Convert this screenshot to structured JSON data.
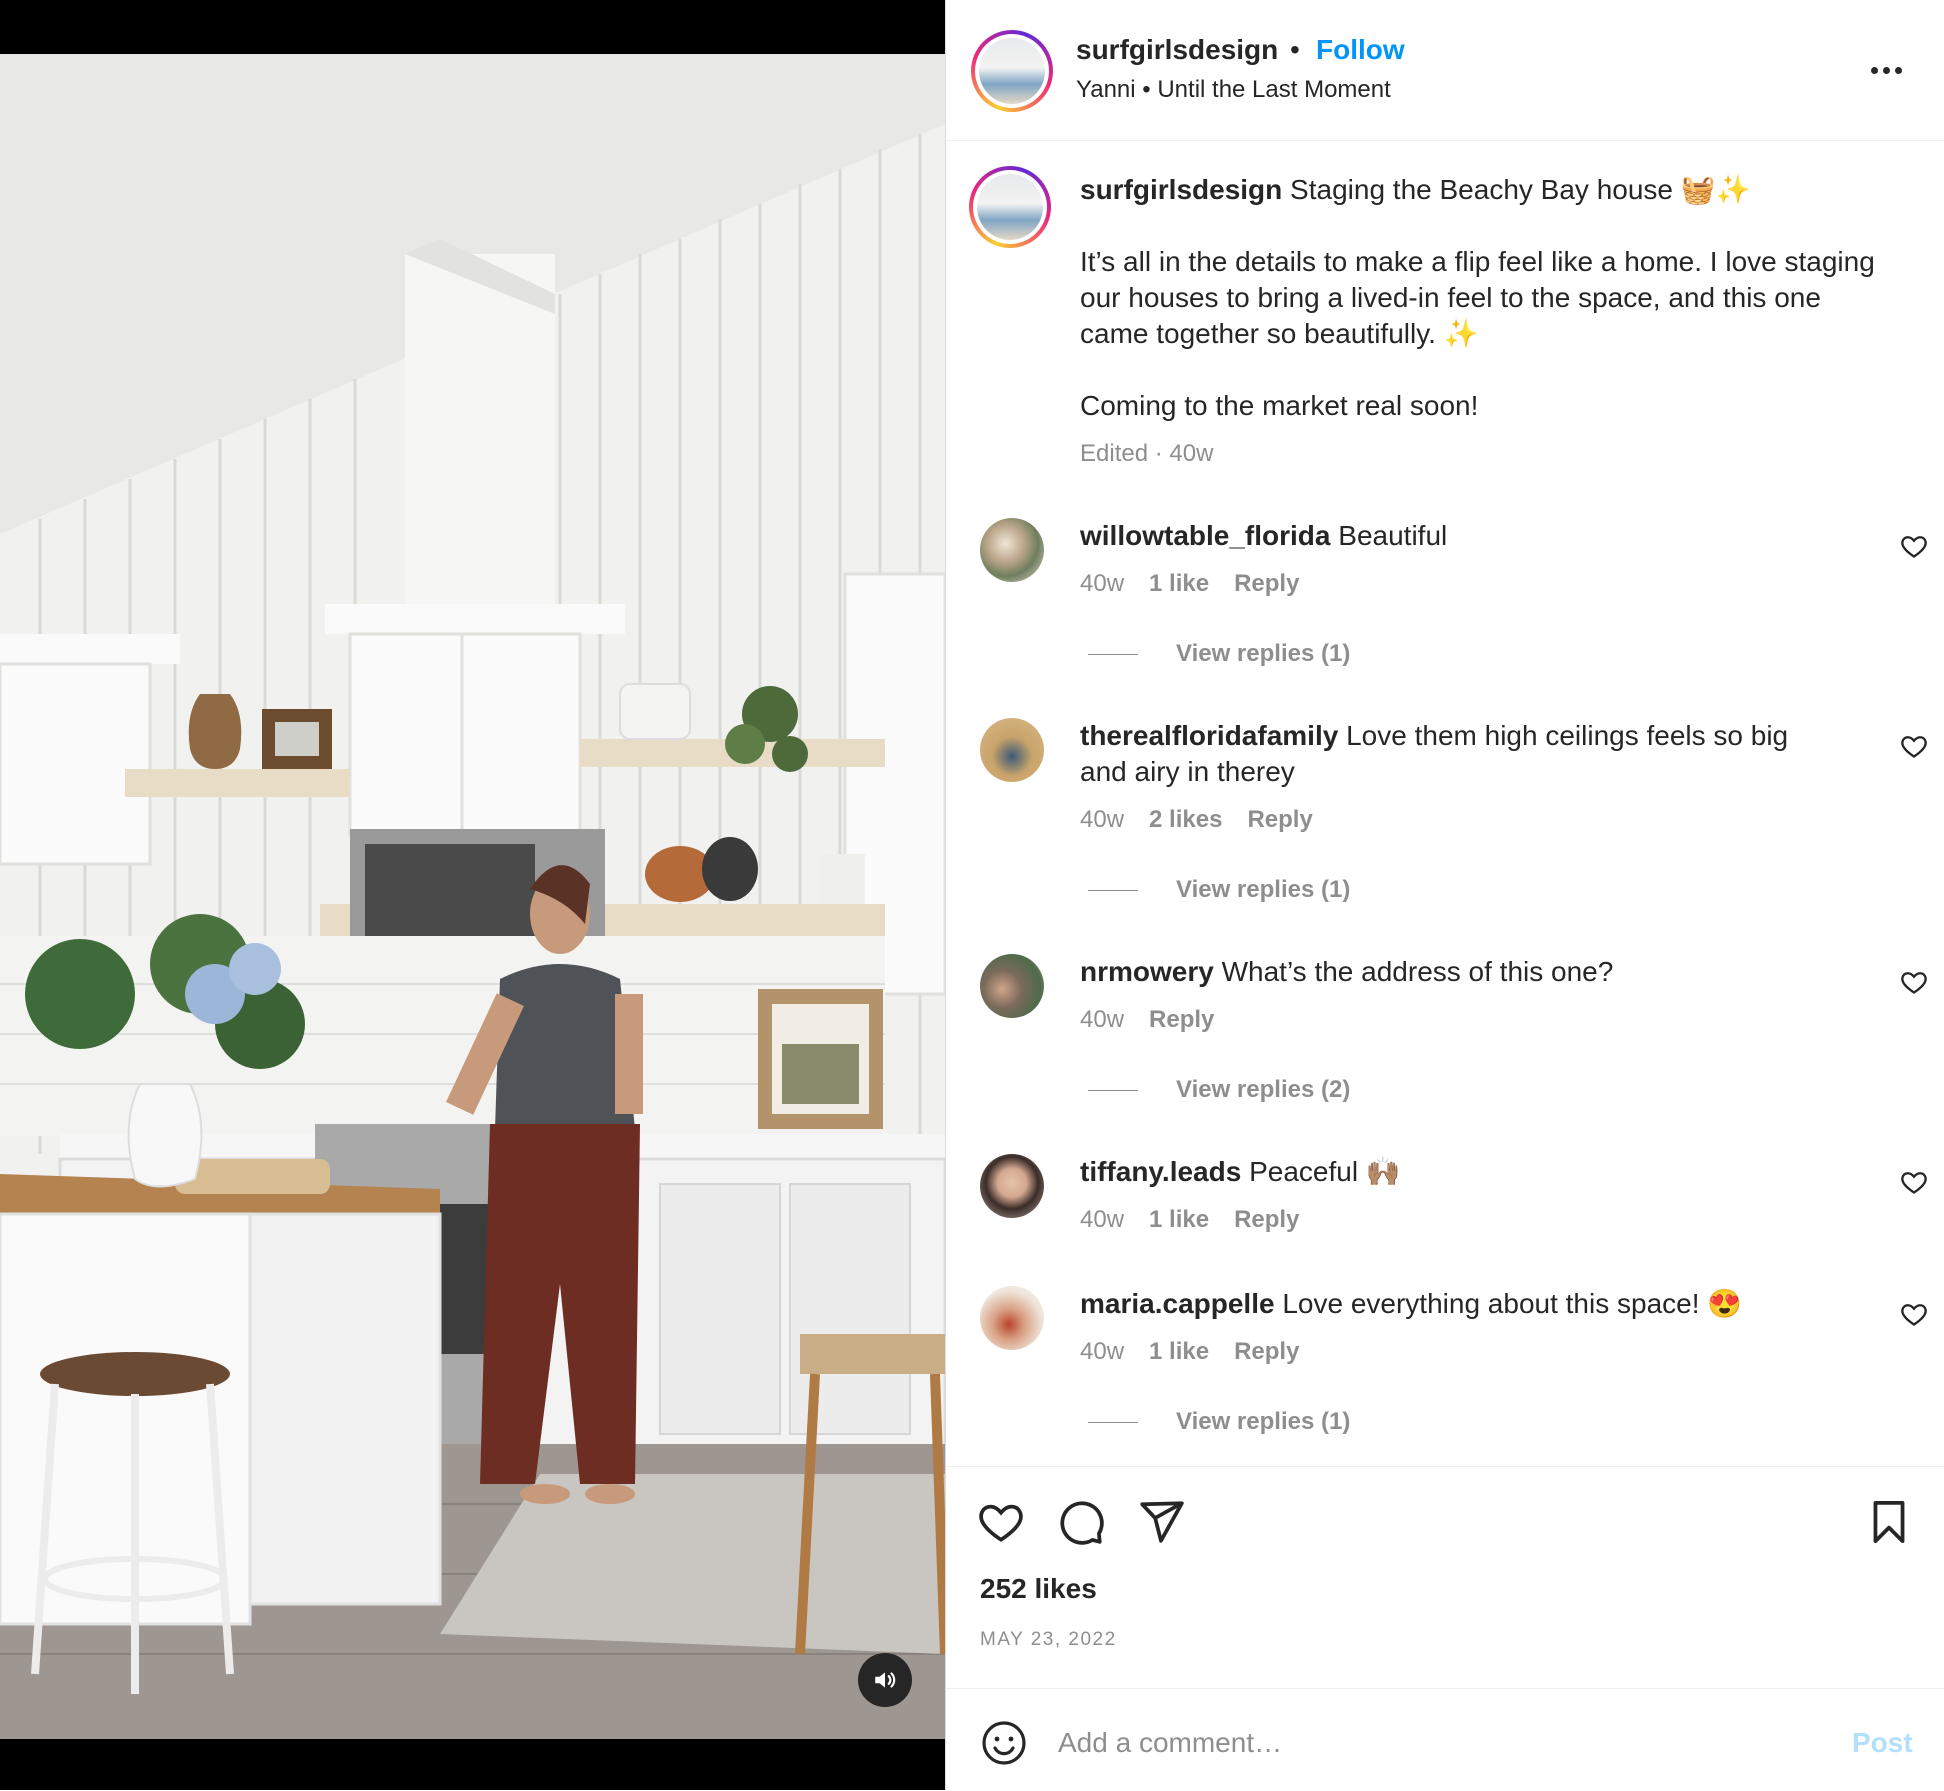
{
  "post": {
    "username": "surfgirlsdesign",
    "separator": "•",
    "follow_label": "Follow",
    "audio": "Yanni • Until the Last Moment",
    "more_icon": "more-horizontal-icon"
  },
  "caption": {
    "username": "surfgirlsdesign",
    "title": "Staging the Beachy Bay house 🧺✨",
    "paragraph1": "It’s all in the details to make a flip feel like a home. I love staging our houses to bring a lived-in feel to the space, and this one came together so beautifully. ✨",
    "paragraph2": "Coming to the market real soon!",
    "meta": "Edited · 40w"
  },
  "comments": [
    {
      "username": "willowtable_florida",
      "text": "Beautiful",
      "time": "40w",
      "likes": "1 like",
      "reply": "Reply",
      "view_replies": "View replies (1)"
    },
    {
      "username": "therealfloridafamily",
      "text": "Love them high ceilings feels so big and airy in therey",
      "time": "40w",
      "likes": "2 likes",
      "reply": "Reply",
      "view_replies": "View replies (1)"
    },
    {
      "username": "nrmowery",
      "text": "What’s the address of this one?",
      "time": "40w",
      "likes": "",
      "reply": "Reply",
      "view_replies": "View replies (2)"
    },
    {
      "username": "tiffany.leads",
      "text": "Peaceful 🙌🏽",
      "time": "40w",
      "likes": "1 like",
      "reply": "Reply",
      "view_replies": ""
    },
    {
      "username": "maria.cappelle",
      "text": "Love everything about this space! 😍",
      "time": "40w",
      "likes": "1 like",
      "reply": "Reply",
      "view_replies": "View replies (1)"
    }
  ],
  "actions": {
    "like_icon": "heart-icon",
    "comment_icon": "comment-icon",
    "share_icon": "paper-plane-icon",
    "save_icon": "bookmark-icon",
    "likes_count": "252 likes",
    "date": "MAY 23, 2022"
  },
  "comment_box": {
    "placeholder": "Add a comment…",
    "post_label": "Post",
    "emoji_icon": "smiley-icon"
  },
  "media": {
    "mute_icon": "speaker-icon"
  },
  "colors": {
    "link_blue": "#0095f6",
    "post_disabled": "#b2dffc",
    "secondary_text": "#8e8e8e",
    "primary_text": "#262626"
  }
}
